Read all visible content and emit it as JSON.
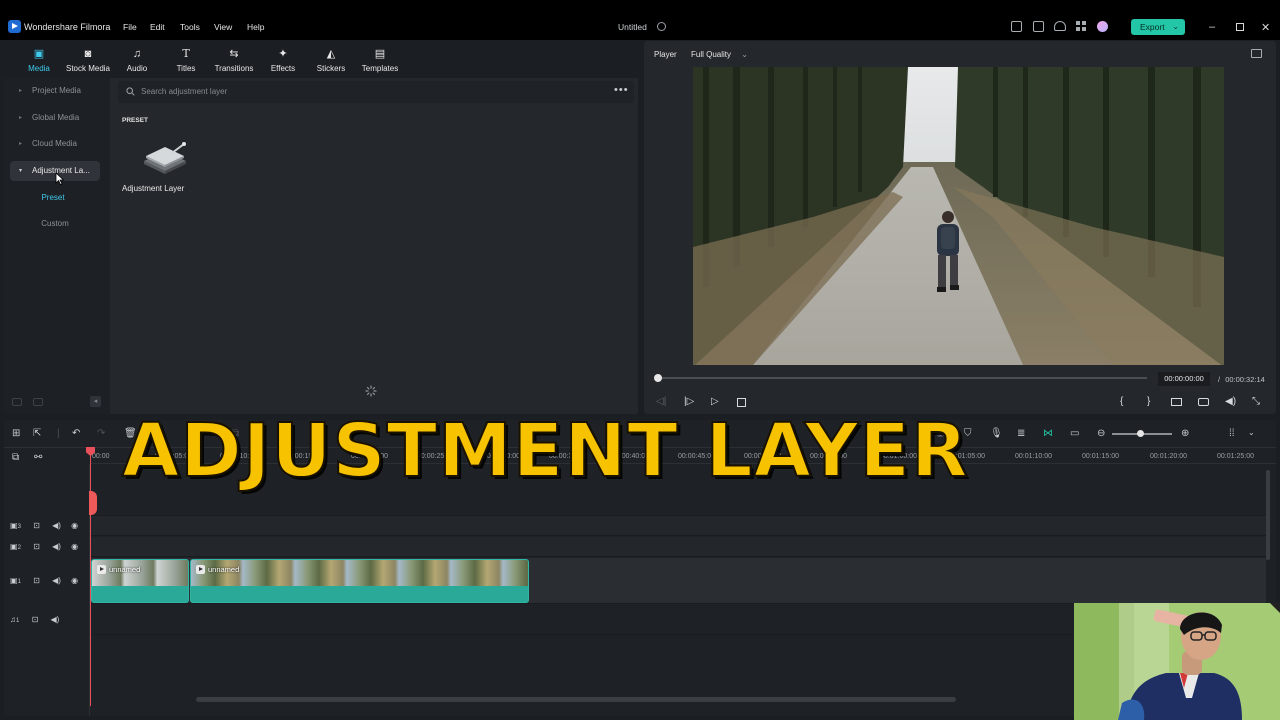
{
  "titlebar": {
    "app_name": "Wondershare Filmora",
    "menu": [
      "File",
      "Edit",
      "Tools",
      "View",
      "Help"
    ],
    "document_title": "Untitled",
    "export_label": "Export",
    "accent": "#23c6a6"
  },
  "media_tabs": [
    {
      "label": "Media",
      "icon": "folder-icon",
      "active": true
    },
    {
      "label": "Stock Media",
      "icon": "stock-icon"
    },
    {
      "label": "Audio",
      "icon": "music-note-icon"
    },
    {
      "label": "Titles",
      "icon": "text-icon"
    },
    {
      "label": "Transitions",
      "icon": "transition-icon"
    },
    {
      "label": "Effects",
      "icon": "sparkle-icon"
    },
    {
      "label": "Stickers",
      "icon": "sticker-icon"
    },
    {
      "label": "Templates",
      "icon": "template-icon"
    }
  ],
  "sidebar": {
    "items": [
      "Project Media",
      "Global Media",
      "Cloud Media",
      "Adjustment La..."
    ],
    "sub_items": [
      "Preset",
      "Custom"
    ],
    "selected_sub": "Preset"
  },
  "search": {
    "placeholder": "Search adjustment layer"
  },
  "library": {
    "section": "PRESET",
    "asset_label": "Adjustment Layer"
  },
  "player": {
    "label": "Player",
    "quality": "Full Quality",
    "current_time": "00:00:00:00",
    "separator": "/",
    "total_time": "00:00:32:14"
  },
  "timeline": {
    "ruler_ticks": [
      "00:00",
      "00:00:05:00",
      "00:00:10:00",
      "00:00:15:00",
      "00:00:20:00",
      "00:00:25:00",
      "00:00:30:00",
      "00:00:35:00",
      "00:00:40:00",
      "00:00:45:00",
      "00:00:50:00",
      "00:00:55:00",
      "00:01:00:00",
      "00:01:05:00",
      "00:01:10:00",
      "00:01:15:00",
      "00:01:20:00",
      "00:01:25:00"
    ],
    "tracks": [
      "3",
      "2",
      "1",
      "1"
    ],
    "clips": [
      {
        "label": "unnamed"
      },
      {
        "label": "unnamed"
      }
    ]
  },
  "overlay": {
    "title": "ADJUSTMENT LAYER",
    "color": "#f7c200"
  }
}
